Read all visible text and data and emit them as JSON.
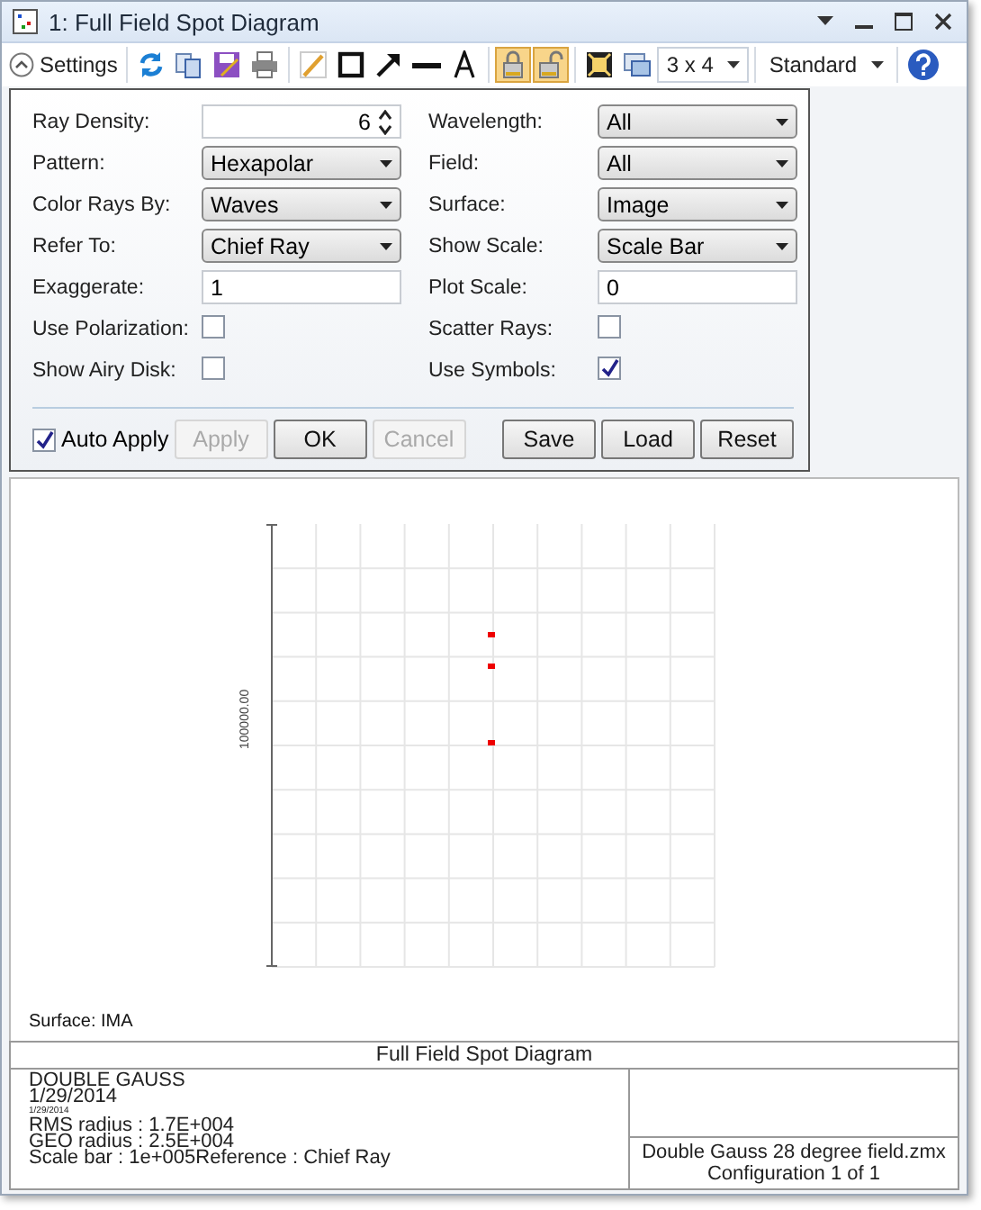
{
  "window": {
    "title": "1: Full Field Spot Diagram"
  },
  "toolbar": {
    "settings_label": "Settings",
    "layout_value": "3 x 4",
    "preset_value": "Standard",
    "tool_buttons": [
      {
        "pressed": false
      },
      {
        "pressed": false
      },
      {
        "pressed": false
      },
      {
        "pressed": false
      },
      {
        "pressed": false
      },
      {
        "pressed": false
      },
      {
        "pressed": false
      },
      {
        "pressed": false
      },
      {
        "pressed": false
      },
      {
        "pressed": true
      },
      {
        "pressed": true
      },
      {
        "pressed": false
      },
      {
        "pressed": false
      }
    ]
  },
  "settings": {
    "left": [
      {
        "kind": "spin",
        "label": "Ray Density:",
        "value": "6"
      },
      {
        "kind": "dropdown",
        "label": "Pattern:",
        "value": "Hexapolar"
      },
      {
        "kind": "dropdown",
        "label": "Color Rays By:",
        "value": "Waves"
      },
      {
        "kind": "dropdown",
        "label": "Refer To:",
        "value": "Chief Ray"
      },
      {
        "kind": "text",
        "label": "Exaggerate:",
        "value": "1"
      },
      {
        "kind": "checkbox",
        "label": "Use Polarization:",
        "checked": false
      },
      {
        "kind": "checkbox",
        "label": "Show Airy Disk:",
        "checked": false
      }
    ],
    "right": [
      {
        "kind": "dropdown",
        "label": "Wavelength:",
        "value": "All"
      },
      {
        "kind": "dropdown",
        "label": "Field:",
        "value": "All"
      },
      {
        "kind": "dropdown",
        "label": "Surface:",
        "value": "Image"
      },
      {
        "kind": "dropdown",
        "label": "Show Scale:",
        "value": "Scale Bar"
      },
      {
        "kind": "text",
        "label": "Plot Scale:",
        "value": "0"
      },
      {
        "kind": "checkbox",
        "label": "Scatter Rays:",
        "checked": false
      },
      {
        "kind": "checkbox",
        "label": "Use Symbols:",
        "checked": true
      }
    ],
    "auto_apply": {
      "label": "Auto Apply",
      "checked": true
    },
    "buttons": [
      {
        "label": "Apply",
        "disabled": true
      },
      {
        "label": "OK",
        "disabled": false
      },
      {
        "label": "Cancel",
        "disabled": true
      }
    ],
    "file_buttons": [
      {
        "label": "Save",
        "disabled": false
      },
      {
        "label": "Load",
        "disabled": false
      },
      {
        "label": "Reset",
        "disabled": false
      }
    ]
  },
  "plot": {
    "scale_label": "100000.00",
    "surface_label": "Surface: IMA"
  },
  "report": {
    "title": "Full Field Spot Diagram",
    "lines": [
      {
        "kind": "normal",
        "text": "DOUBLE GAUSS"
      },
      {
        "kind": "normal",
        "text": "1/29/2014"
      },
      {
        "kind": "small",
        "text": "1/29/2014"
      },
      {
        "kind": "normal",
        "text": "RMS radius : 1.7E+004"
      },
      {
        "kind": "normal",
        "text": "GEO radius : 2.5E+004"
      },
      {
        "kind": "normal",
        "text": "Scale bar  : 1e+005Reference  : Chief Ray"
      }
    ],
    "file_name": "Double Gauss 28 degree field.zmx",
    "configuration": "Configuration 1 of 1"
  }
}
